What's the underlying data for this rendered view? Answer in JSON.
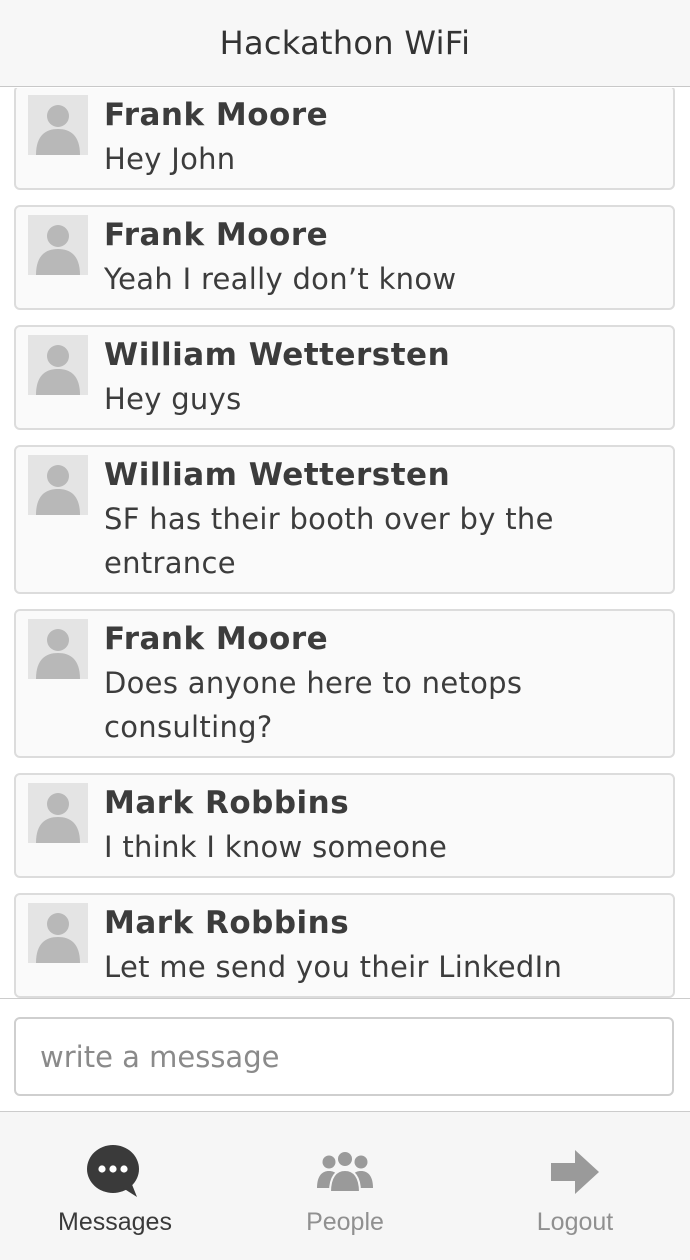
{
  "header": {
    "title": "Hackathon WiFi"
  },
  "messages": [
    {
      "name": "Frank Moore",
      "text": "Hey John"
    },
    {
      "name": "Frank Moore",
      "text": "Yeah I really don’t know"
    },
    {
      "name": "William Wettersten",
      "text": "Hey guys"
    },
    {
      "name": "William Wettersten",
      "text": "SF has their booth over by the entrance"
    },
    {
      "name": "Frank Moore",
      "text": "Does anyone here to netops consulting?"
    },
    {
      "name": "Mark Robbins",
      "text": "I think I know someone"
    },
    {
      "name": "Mark Robbins",
      "text": "Let me send you their LinkedIn"
    }
  ],
  "compose": {
    "placeholder": "write a message"
  },
  "tabs": [
    {
      "label": "Messages",
      "icon": "chat-bubble-icon",
      "active": true
    },
    {
      "label": "People",
      "icon": "people-icon",
      "active": false
    },
    {
      "label": "Logout",
      "icon": "arrow-right-icon",
      "active": false
    }
  ],
  "colors": {
    "active_icon": "#3a3a3a",
    "inactive_icon": "#9a9a9a",
    "avatar_bg": "#e4e4e4",
    "avatar_figure": "#b8b8b8"
  }
}
